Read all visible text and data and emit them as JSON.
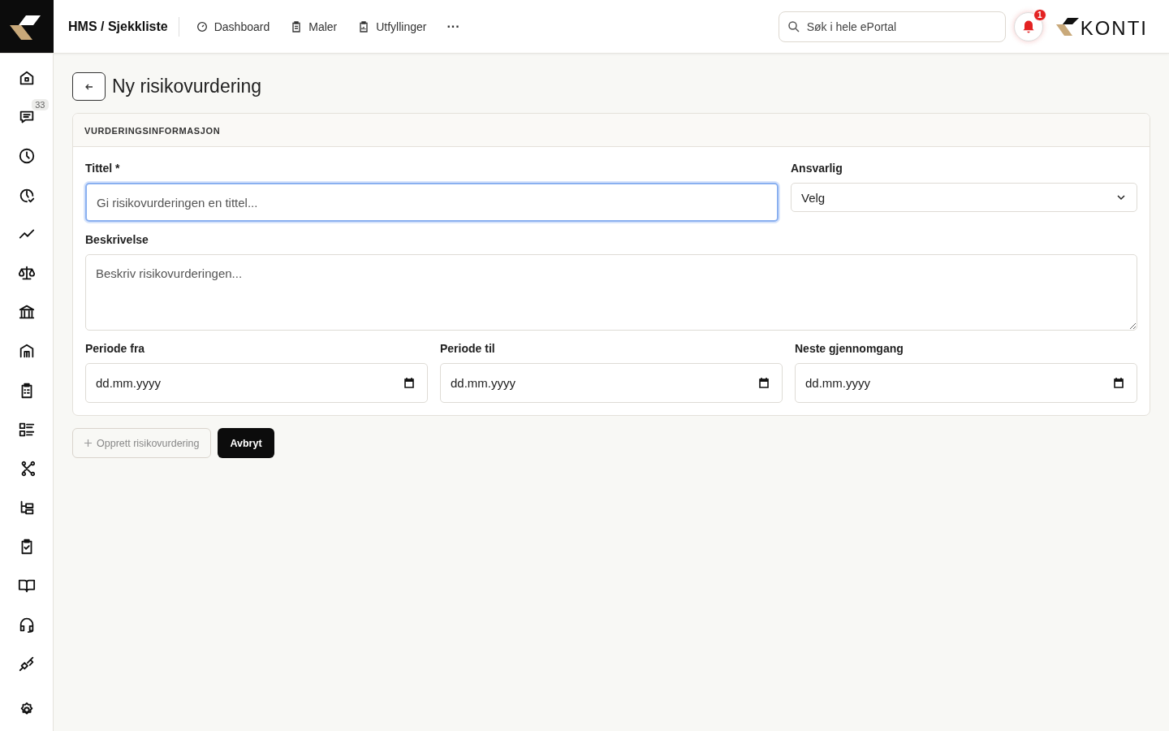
{
  "header": {
    "breadcrumb": "HMS / Sjekkliste",
    "nav": [
      {
        "label": "Dashboard"
      },
      {
        "label": "Maler"
      },
      {
        "label": "Utfyllinger"
      }
    ],
    "more": "···",
    "search": {
      "placeholder": "Søk i hele ePortal"
    },
    "notifications": "1",
    "logo_text": "KONTI"
  },
  "sidebar": {
    "chat_badge": "33"
  },
  "page": {
    "title": "Ny risikovurdering"
  },
  "card": {
    "heading": "VURDERINGSINFORMASJON",
    "title_field": {
      "label": "Tittel *",
      "placeholder": "Gi risikovurderingen en tittel...",
      "focused": true
    },
    "responsible": {
      "label": "Ansvarlig",
      "value": "Velg"
    },
    "description": {
      "label": "Beskrivelse",
      "placeholder": "Beskriv risikovurderingen..."
    },
    "dates": [
      {
        "label": "Periode fra",
        "placeholder": "dd.mm.yyyy"
      },
      {
        "label": "Periode til",
        "placeholder": "dd.mm.yyyy"
      },
      {
        "label": "Neste gjennomgang",
        "placeholder": "dd.mm.yyyy"
      }
    ]
  },
  "actions": {
    "create": {
      "label": "Opprett risikovurdering",
      "disabled": true
    },
    "cancel": {
      "label": "Avbryt"
    }
  }
}
